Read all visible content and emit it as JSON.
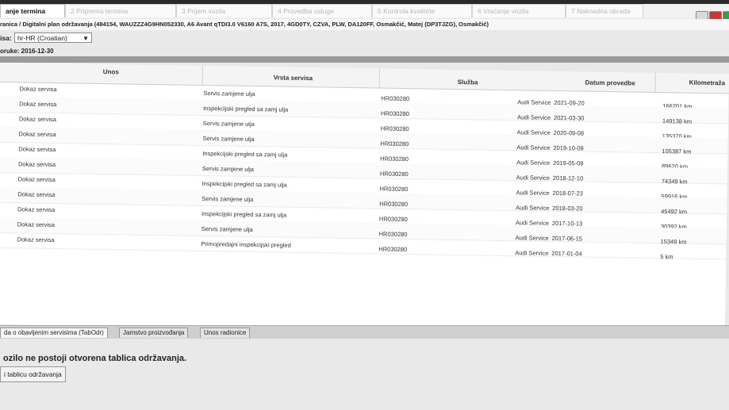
{
  "wizard_tabs": [
    {
      "label": "anje termina",
      "active": true
    },
    {
      "label": "2 Priprema termina",
      "active": false
    },
    {
      "label": "3 Prijem vozila",
      "active": false
    },
    {
      "label": "4 Provedba usluge",
      "active": false
    },
    {
      "label": "5 Kontrola kvalitete",
      "active": false
    },
    {
      "label": "6 Vraćanje vozila",
      "active": false
    },
    {
      "label": "7 Naknadna obrada",
      "active": false
    }
  ],
  "vehicle_line": "ranica / Digitalni plan održavanja (484154, WAUZZZ4G9HN052330, A6 Avant qTDI3.0 V6160 A7S, 2017, 4GD0TY, CZVA, PLW, DA120FF, Osmakčić, Matej (DP3TJZG), Osmakčić)",
  "language": {
    "label": "isa:",
    "value": "hr-HR (Croatian)"
  },
  "date_line": "oruke: 2016-12-30",
  "table": {
    "headers": {
      "unos": "Unos",
      "vrsta": "Vrsta servisa",
      "sluzba": "Služba",
      "datum": "Datum provedbe",
      "km": "Kilometraža"
    },
    "rows": [
      {
        "unos": "Dokaz servisa",
        "vrsta": "Servis zamjene ulja",
        "sluzba": "HR030280",
        "provider": "Audi Service",
        "datum": "2021-09-20",
        "km": "166201 km"
      },
      {
        "unos": "Dokaz servisa",
        "vrsta": "Inspekcijski pregled sa zamj ulja",
        "sluzba": "HR030280",
        "provider": "Audi Service",
        "datum": "2021-03-30",
        "km": "149138 km"
      },
      {
        "unos": "Dokaz servisa",
        "vrsta": "Servis zamjene ulja",
        "sluzba": "HR030280",
        "provider": "Audi Service",
        "datum": "2020-09-08",
        "km": "135370 km"
      },
      {
        "unos": "Dokaz servisa",
        "vrsta": "Servis zamjene ulja",
        "sluzba": "HR030280",
        "provider": "Audi Service",
        "datum": "2019-10-09",
        "km": "105387 km"
      },
      {
        "unos": "Dokaz servisa",
        "vrsta": "Inspekcijski pregled sa zamj ulja",
        "sluzba": "HR030280",
        "provider": "Audi Service",
        "datum": "2019-05-09",
        "km": "89620 km"
      },
      {
        "unos": "Dokaz servisa",
        "vrsta": "Servis zamjene ulja",
        "sluzba": "HR030280",
        "provider": "Audi Service",
        "datum": "2018-12-10",
        "km": "74349 km"
      },
      {
        "unos": "Dokaz servisa",
        "vrsta": "Inspekcijski pregled sa zamj ulja",
        "sluzba": "HR030280",
        "provider": "Audi Service",
        "datum": "2018-07-23",
        "km": "59916 km"
      },
      {
        "unos": "Dokaz servisa",
        "vrsta": "Servis zamjene ulja",
        "sluzba": "HR030280",
        "provider": "Audi Service",
        "datum": "2018-03-20",
        "km": "45492 km"
      },
      {
        "unos": "Dokaz servisa",
        "vrsta": "Inspekcijski pregled sa zamj ulja",
        "sluzba": "HR030280",
        "provider": "Audi Service",
        "datum": "2017-10-13",
        "km": "30392 km"
      },
      {
        "unos": "Dokaz servisa",
        "vrsta": "Servis zamjene ulja",
        "sluzba": "HR030280",
        "provider": "Audi Service",
        "datum": "2017-06-15",
        "km": "15349 km"
      },
      {
        "unos": "Dokaz servisa",
        "vrsta": "Primopredajni inspekcijski pregled",
        "sluzba": "HR030280",
        "provider": "Audi Service",
        "datum": "2017-01-04",
        "km": "5 km"
      }
    ]
  },
  "bottom_tabs": [
    {
      "label": "da o obavljenim servisima (TabOdr)",
      "active": true
    },
    {
      "label": "Jamstvo proizvođanja",
      "active": false
    },
    {
      "label": "Unos radionice",
      "active": false
    }
  ],
  "message": "ozilo ne postoji otvorena tablica održavanja.",
  "open_button": "i tablicu održavanja",
  "colors": {
    "accent_red": "#c43a3a",
    "accent_green": "#3b9a49"
  }
}
